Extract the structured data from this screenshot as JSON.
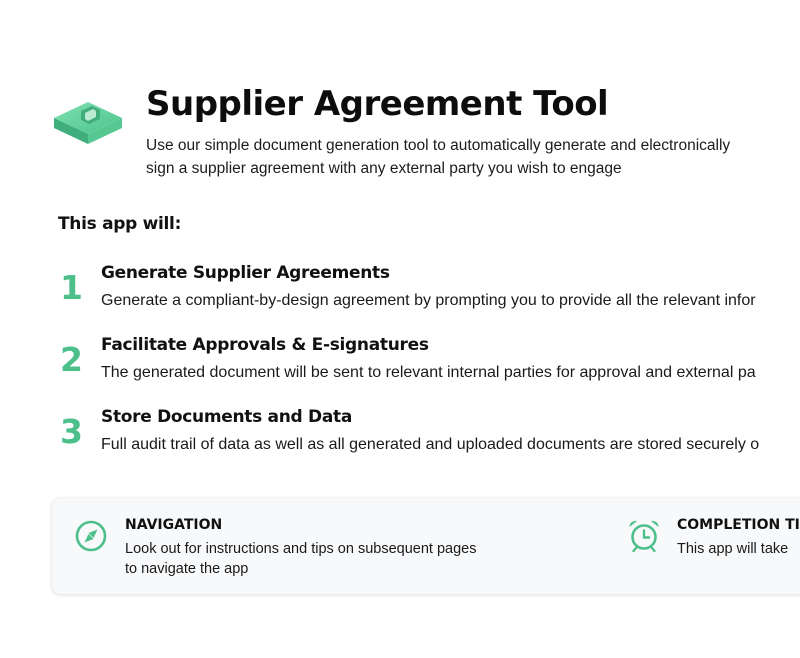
{
  "header": {
    "title": "Supplier Agreement Tool",
    "subtitle": "Use our simple document generation tool to automatically generate and electronically sign a supplier agreement with any external party you wish to engage",
    "logo_icon": "document-cube-icon"
  },
  "section_heading": "This app will:",
  "steps": [
    {
      "number": "1",
      "title": "Generate Supplier Agreements",
      "description": "Generate a compliant-by-design agreement by prompting you to provide all the relevant infor"
    },
    {
      "number": "2",
      "title": "Facilitate Approvals & E-signatures",
      "description": "The generated document will be sent to relevant internal parties for approval and external pa"
    },
    {
      "number": "3",
      "title": "Store Documents and Data",
      "description": "Full audit trail of data as well as all generated and uploaded documents are stored securely o"
    }
  ],
  "info_card": {
    "navigation": {
      "icon": "compass-icon",
      "title": "NAVIGATION",
      "text": "Look out for instructions and tips on subsequent pages to navigate the app"
    },
    "completion_time": {
      "icon": "alarm-clock-icon",
      "title": "COMPLETION TIM",
      "text": "This app will take"
    }
  },
  "colors": {
    "accent": "#4cbf8a",
    "card_background": "#f8f9fb",
    "text": "#111111"
  }
}
